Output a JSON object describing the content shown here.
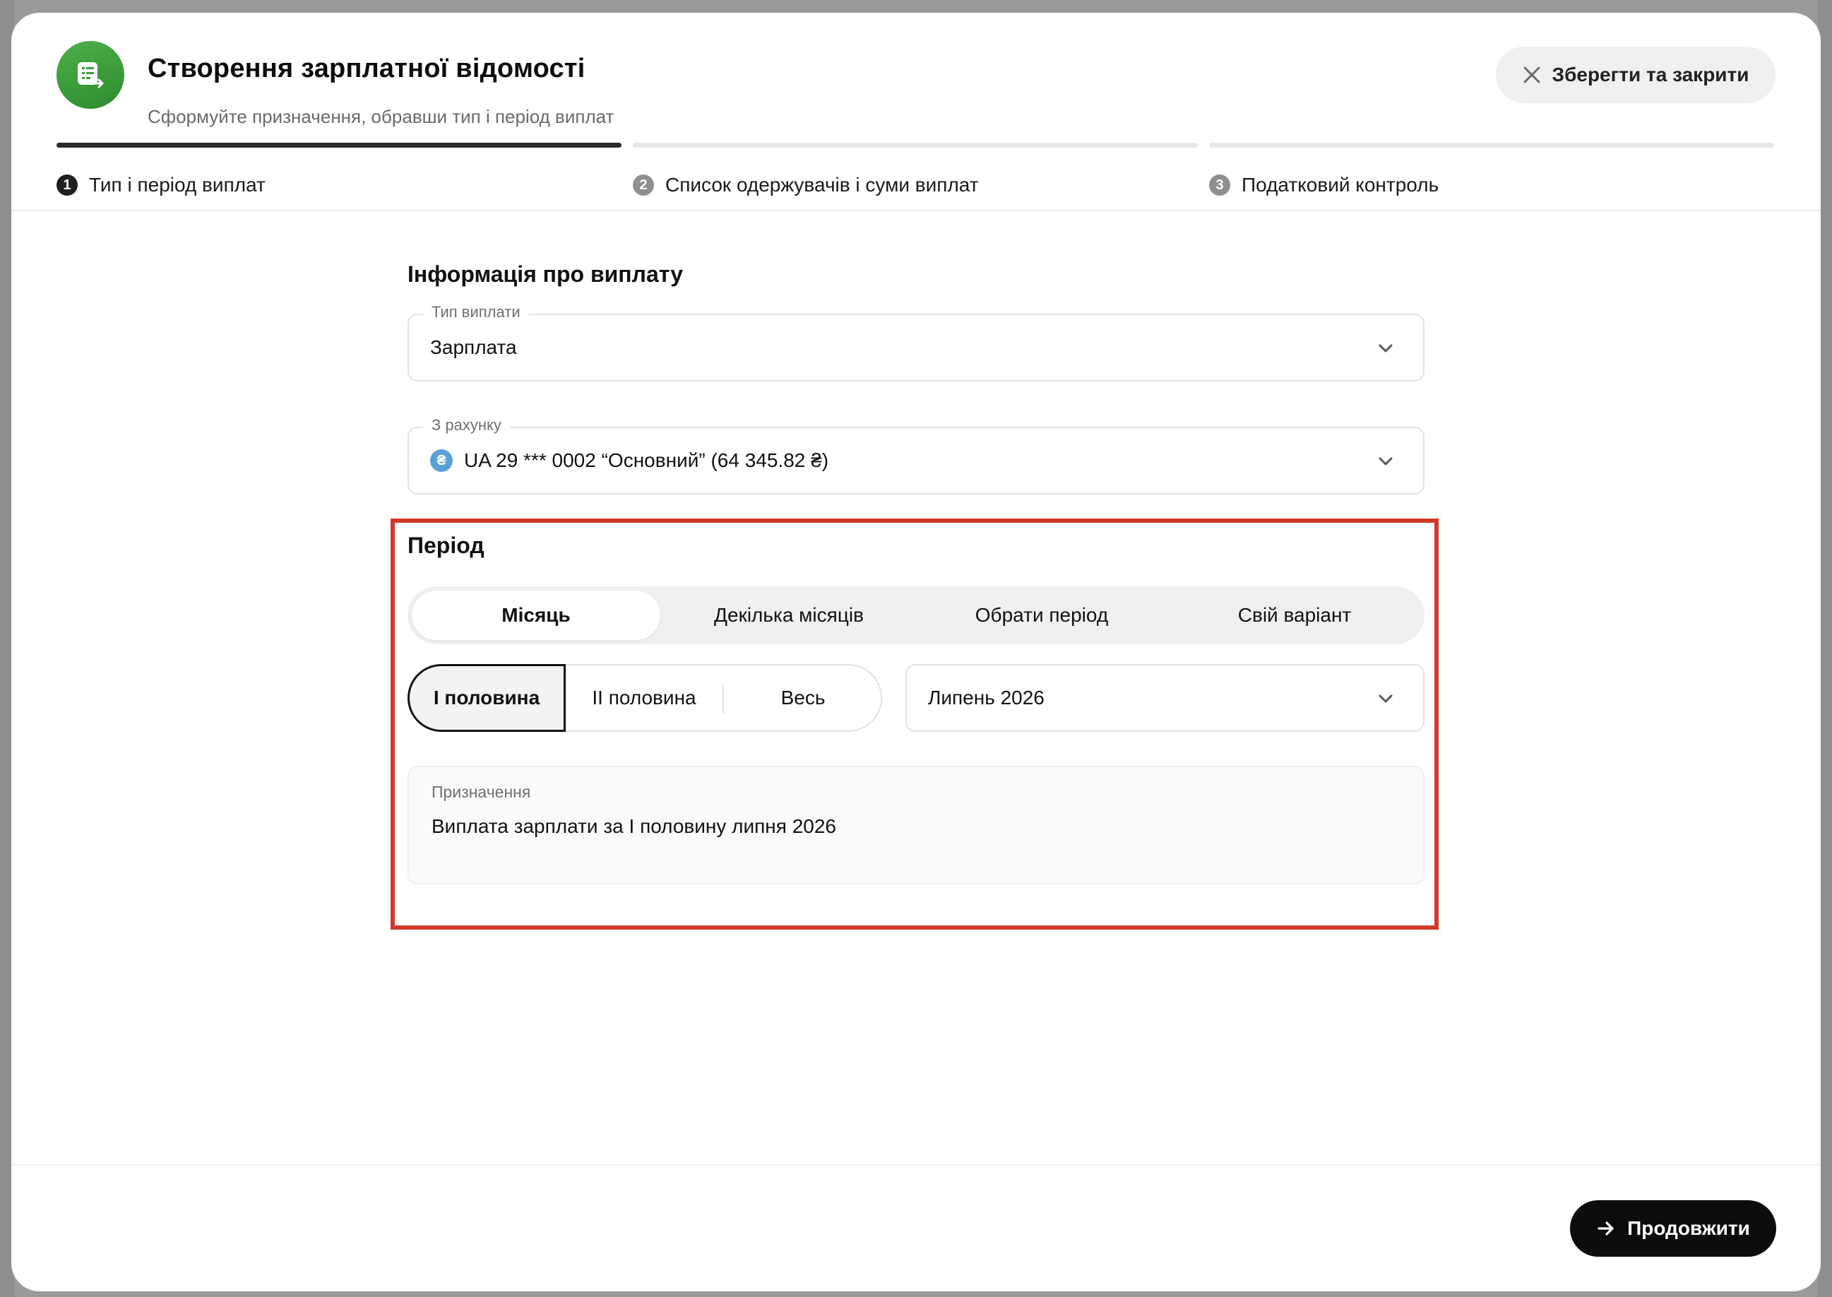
{
  "header": {
    "title": "Створення зарплатної відомості",
    "subtitle": "Сформуйте призначення, обравши тип і період виплат",
    "close_label": "Зберегти та закрити",
    "icon": "payroll-sheet-icon",
    "icon_color": "#3a9e38"
  },
  "steps": [
    {
      "number": "1",
      "label": "Тип і період виплат",
      "active": true
    },
    {
      "number": "2",
      "label": "Список одержувачів і суми виплат",
      "active": false
    },
    {
      "number": "3",
      "label": "Податковий контроль",
      "active": false
    }
  ],
  "payment_info": {
    "section_title": "Інформація про виплату",
    "payment_type": {
      "label": "Тип виплати",
      "value": "Зарплата"
    },
    "account": {
      "label": "З рахунку",
      "value": "UA 29 *** 0002 “Основний” (64 345.82 ₴)",
      "currency_icon": "hryvnia-icon"
    }
  },
  "period": {
    "section_title": "Період",
    "tabs": [
      "Місяць",
      "Декілька місяців",
      "Обрати період",
      "Свій варіант"
    ],
    "active_tab": "Місяць",
    "halves": [
      "I половина",
      "II половина",
      "Весь"
    ],
    "active_half": "I половина",
    "month": "Липень 2026"
  },
  "purpose": {
    "label": "Призначення",
    "value": "Виплата зарплати за I половину липня 2026"
  },
  "footer": {
    "continue_label": "Продовжити"
  },
  "colors": {
    "highlight": "#d03a2b",
    "primary_button": "#0c0c0c"
  }
}
